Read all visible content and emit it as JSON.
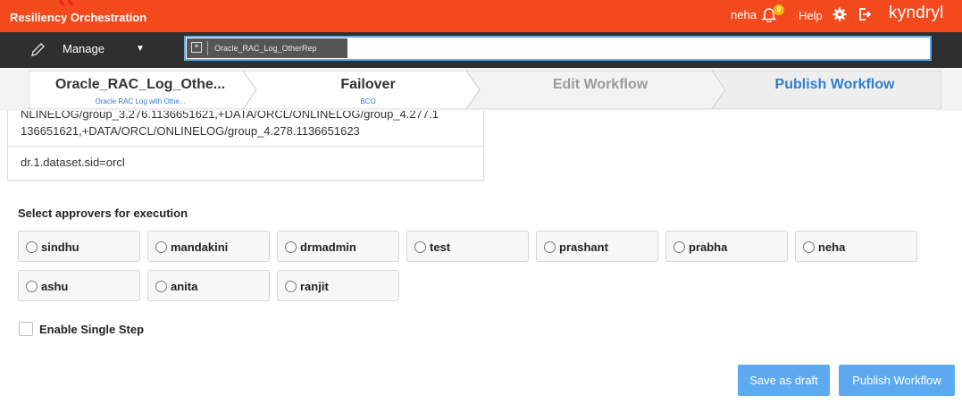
{
  "header": {
    "app_title": "Resiliency Orchestration",
    "user": "neha",
    "notification_count": "9",
    "help_label": "Help",
    "brand": "kyndryl",
    "icons": [
      "bell-icon",
      "gear-icon",
      "logout-icon"
    ],
    "brand_color": "#f24a1d"
  },
  "toolbar": {
    "manage_label": "Manage",
    "breadcrumb_chip": "Oracle_RAC_Log_OtherRep"
  },
  "steps": [
    {
      "title": "Oracle_RAC_Log_Othe...",
      "subtitle": "Oracle RAC Log with Othe...",
      "state": "visited"
    },
    {
      "title": "Failover",
      "subtitle": "BCO",
      "state": "visited"
    },
    {
      "title": "Edit Workflow",
      "subtitle": "",
      "state": "disabled"
    },
    {
      "title": "Publish Workflow",
      "subtitle": "",
      "state": "active"
    }
  ],
  "card": {
    "line1": "NLINELOG/group_3.276.1136651621,+DATA/ORCL/ONLINELOG/group_4.277.1",
    "line2": "136651621,+DATA/ORCL/ONLINELOG/group_4.278.1136651623",
    "line3": "dr.1.dataset.sid=orcl"
  },
  "approvers": {
    "title": "Select approvers for execution",
    "list": [
      "sindhu",
      "mandakini",
      "drmadmin",
      "test",
      "prashant",
      "prabha",
      "neha",
      "ashu",
      "anita",
      "ranjit"
    ]
  },
  "single_step": {
    "label": "Enable Single Step",
    "checked": false
  },
  "buttons": {
    "save_draft": "Save as draft",
    "publish": "Publish Workflow"
  },
  "colors": {
    "accent": "#5eaaf0",
    "active_step": "#2f7fd0"
  }
}
